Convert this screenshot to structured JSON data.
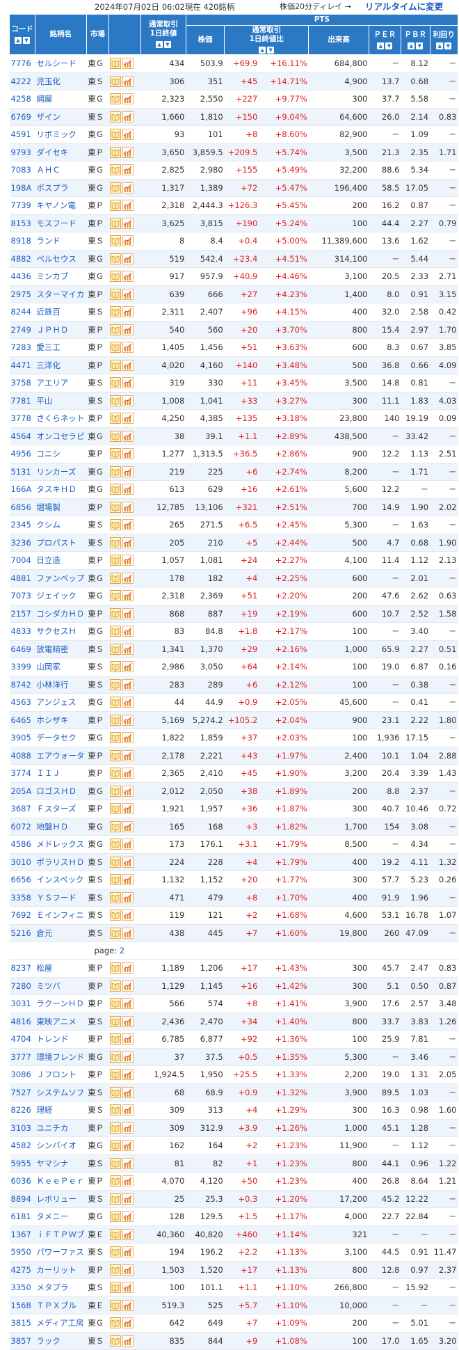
{
  "topbar": {
    "date": "2024年07月02日  06:02現在  420銘柄",
    "delay": "株価20分ディレイ →",
    "realtime_link": "リアルタイムに変更"
  },
  "headers": {
    "code": "コード",
    "name": "銘柄名",
    "market": "市場",
    "pts": "PTS",
    "close": "通常取引\n1日終値",
    "price": "株価",
    "change": "通常取引\n1日終値比",
    "volume": "出来高",
    "per": "ＰＥＲ",
    "pbr": "ＰＢＲ",
    "yield": "利回り"
  },
  "icons": {
    "book": "shikiho-book-icon",
    "chart": "chart-icon"
  },
  "colors": {
    "header_bg": "#2b78c5",
    "link": "#1a5dc0",
    "up": "#e02020"
  },
  "rows": [
    {
      "code": "7776",
      "name": "セルシード",
      "market": "東Ｇ",
      "close": "434",
      "price": "503.9",
      "chg": "+69.9",
      "pct": "+16.11%",
      "vol": "684,800",
      "per": "－",
      "pbr": "8.12",
      "yield": "－"
    },
    {
      "code": "4222",
      "name": "児玉化",
      "market": "東Ｓ",
      "close": "306",
      "price": "351",
      "chg": "+45",
      "pct": "+14.71%",
      "vol": "4,900",
      "per": "13.7",
      "pbr": "0.68",
      "yield": "－"
    },
    {
      "code": "4258",
      "name": "網屋",
      "market": "東Ｇ",
      "close": "2,323",
      "price": "2,550",
      "chg": "+227",
      "pct": "+9.77%",
      "vol": "300",
      "per": "37.7",
      "pbr": "5.58",
      "yield": "－"
    },
    {
      "code": "6769",
      "name": "ザイン",
      "market": "東Ｓ",
      "close": "1,660",
      "price": "1,810",
      "chg": "+150",
      "pct": "+9.04%",
      "vol": "64,600",
      "per": "26.0",
      "pbr": "2.14",
      "yield": "0.83"
    },
    {
      "code": "4591",
      "name": "リボミック",
      "market": "東Ｇ",
      "close": "93",
      "price": "101",
      "chg": "+8",
      "pct": "+8.60%",
      "vol": "82,900",
      "per": "－",
      "pbr": "1.09",
      "yield": "－"
    },
    {
      "code": "9793",
      "name": "ダイセキ",
      "market": "東Ｐ",
      "close": "3,650",
      "price": "3,859.5",
      "chg": "+209.5",
      "pct": "+5.74%",
      "vol": "3,500",
      "per": "21.3",
      "pbr": "2.35",
      "yield": "1.71"
    },
    {
      "code": "7083",
      "name": "ＡＨＣ",
      "market": "東Ｇ",
      "close": "2,825",
      "price": "2,980",
      "chg": "+155",
      "pct": "+5.49%",
      "vol": "32,200",
      "per": "88.6",
      "pbr": "5.34",
      "yield": "－"
    },
    {
      "code": "198A",
      "name": "ポスプラ",
      "market": "東Ｇ",
      "close": "1,317",
      "price": "1,389",
      "chg": "+72",
      "pct": "+5.47%",
      "vol": "196,400",
      "per": "58.5",
      "pbr": "17.05",
      "yield": "－"
    },
    {
      "code": "7739",
      "name": "キヤノン電",
      "market": "東Ｐ",
      "close": "2,318",
      "price": "2,444.3",
      "chg": "+126.3",
      "pct": "+5.45%",
      "vol": "200",
      "per": "16.2",
      "pbr": "0.87",
      "yield": "－"
    },
    {
      "code": "8153",
      "name": "モスフード",
      "market": "東Ｐ",
      "close": "3,625",
      "price": "3,815",
      "chg": "+190",
      "pct": "+5.24%",
      "vol": "100",
      "per": "44.4",
      "pbr": "2.27",
      "yield": "0.79"
    },
    {
      "code": "8918",
      "name": "ランド",
      "market": "東Ｓ",
      "close": "8",
      "price": "8.4",
      "chg": "+0.4",
      "pct": "+5.00%",
      "vol": "11,389,600",
      "per": "13.6",
      "pbr": "1.62",
      "yield": "－"
    },
    {
      "code": "4882",
      "name": "ペルセウス",
      "market": "東Ｇ",
      "close": "519",
      "price": "542.4",
      "chg": "+23.4",
      "pct": "+4.51%",
      "vol": "314,100",
      "per": "－",
      "pbr": "5.44",
      "yield": "－"
    },
    {
      "code": "4436",
      "name": "ミンカブ",
      "market": "東Ｇ",
      "close": "917",
      "price": "957.9",
      "chg": "+40.9",
      "pct": "+4.46%",
      "vol": "3,100",
      "per": "20.5",
      "pbr": "2.33",
      "yield": "2.71"
    },
    {
      "code": "2975",
      "name": "スターマイカ",
      "market": "東Ｐ",
      "close": "639",
      "price": "666",
      "chg": "+27",
      "pct": "+4.23%",
      "vol": "1,400",
      "per": "8.0",
      "pbr": "0.91",
      "yield": "3.15"
    },
    {
      "code": "8244",
      "name": "近鉄百",
      "market": "東Ｓ",
      "close": "2,311",
      "price": "2,407",
      "chg": "+96",
      "pct": "+4.15%",
      "vol": "400",
      "per": "32.0",
      "pbr": "2.58",
      "yield": "0.42"
    },
    {
      "code": "2749",
      "name": "ＪＰＨＤ",
      "market": "東Ｐ",
      "close": "540",
      "price": "560",
      "chg": "+20",
      "pct": "+3.70%",
      "vol": "800",
      "per": "15.4",
      "pbr": "2.97",
      "yield": "1.70"
    },
    {
      "code": "7283",
      "name": "愛三工",
      "market": "東Ｐ",
      "close": "1,405",
      "price": "1,456",
      "chg": "+51",
      "pct": "+3.63%",
      "vol": "600",
      "per": "8.3",
      "pbr": "0.67",
      "yield": "3.85"
    },
    {
      "code": "4471",
      "name": "三洋化",
      "market": "東Ｐ",
      "close": "4,020",
      "price": "4,160",
      "chg": "+140",
      "pct": "+3.48%",
      "vol": "500",
      "per": "36.8",
      "pbr": "0.66",
      "yield": "4.09"
    },
    {
      "code": "3758",
      "name": "アエリア",
      "market": "東Ｓ",
      "close": "319",
      "price": "330",
      "chg": "+11",
      "pct": "+3.45%",
      "vol": "3,500",
      "per": "14.8",
      "pbr": "0.81",
      "yield": "－"
    },
    {
      "code": "7781",
      "name": "平山",
      "market": "東Ｓ",
      "close": "1,008",
      "price": "1,041",
      "chg": "+33",
      "pct": "+3.27%",
      "vol": "300",
      "per": "11.1",
      "pbr": "1.83",
      "yield": "4.03"
    },
    {
      "code": "3778",
      "name": "さくらネット",
      "market": "東Ｐ",
      "close": "4,250",
      "price": "4,385",
      "chg": "+135",
      "pct": "+3.18%",
      "vol": "23,800",
      "per": "140",
      "pbr": "19.19",
      "yield": "0.09"
    },
    {
      "code": "4564",
      "name": "オンコセラピ",
      "market": "東Ｇ",
      "close": "38",
      "price": "39.1",
      "chg": "+1.1",
      "pct": "+2.89%",
      "vol": "438,500",
      "per": "－",
      "pbr": "33.42",
      "yield": "－"
    },
    {
      "code": "4956",
      "name": "コニシ",
      "market": "東Ｐ",
      "close": "1,277",
      "price": "1,313.5",
      "chg": "+36.5",
      "pct": "+2.86%",
      "vol": "900",
      "per": "12.2",
      "pbr": "1.13",
      "yield": "2.51"
    },
    {
      "code": "5131",
      "name": "リンカーズ",
      "market": "東Ｇ",
      "close": "219",
      "price": "225",
      "chg": "+6",
      "pct": "+2.74%",
      "vol": "8,200",
      "per": "－",
      "pbr": "1.71",
      "yield": "－"
    },
    {
      "code": "166A",
      "name": "タスキＨＤ",
      "market": "東Ｇ",
      "close": "613",
      "price": "629",
      "chg": "+16",
      "pct": "+2.61%",
      "vol": "5,600",
      "per": "12.2",
      "pbr": "－",
      "yield": "－"
    },
    {
      "code": "6856",
      "name": "堀場製",
      "market": "東Ｐ",
      "close": "12,785",
      "price": "13,106",
      "chg": "+321",
      "pct": "+2.51%",
      "vol": "700",
      "per": "14.9",
      "pbr": "1.90",
      "yield": "2.02"
    },
    {
      "code": "2345",
      "name": "クシム",
      "market": "東Ｓ",
      "close": "265",
      "price": "271.5",
      "chg": "+6.5",
      "pct": "+2.45%",
      "vol": "5,300",
      "per": "－",
      "pbr": "1.63",
      "yield": "－"
    },
    {
      "code": "3236",
      "name": "プロパスト",
      "market": "東Ｓ",
      "close": "205",
      "price": "210",
      "chg": "+5",
      "pct": "+2.44%",
      "vol": "500",
      "per": "4.7",
      "pbr": "0.68",
      "yield": "1.90"
    },
    {
      "code": "7004",
      "name": "日立造",
      "market": "東Ｐ",
      "close": "1,057",
      "price": "1,081",
      "chg": "+24",
      "pct": "+2.27%",
      "vol": "4,100",
      "per": "11.4",
      "pbr": "1.12",
      "yield": "2.13"
    },
    {
      "code": "4881",
      "name": "ファンペップ",
      "market": "東Ｇ",
      "close": "178",
      "price": "182",
      "chg": "+4",
      "pct": "+2.25%",
      "vol": "600",
      "per": "－",
      "pbr": "2.01",
      "yield": "－"
    },
    {
      "code": "7073",
      "name": "ジェイック",
      "market": "東Ｇ",
      "close": "2,318",
      "price": "2,369",
      "chg": "+51",
      "pct": "+2.20%",
      "vol": "200",
      "per": "47.6",
      "pbr": "2.62",
      "yield": "0.63"
    },
    {
      "code": "2157",
      "name": "コシダカＨＤ",
      "market": "東Ｐ",
      "close": "868",
      "price": "887",
      "chg": "+19",
      "pct": "+2.19%",
      "vol": "600",
      "per": "10.7",
      "pbr": "2.52",
      "yield": "1.58"
    },
    {
      "code": "4833",
      "name": "サクセスＨ",
      "market": "東Ｇ",
      "close": "83",
      "price": "84.8",
      "chg": "+1.8",
      "pct": "+2.17%",
      "vol": "100",
      "per": "－",
      "pbr": "3.40",
      "yield": "－"
    },
    {
      "code": "6469",
      "name": "放電精密",
      "market": "東Ｓ",
      "close": "1,341",
      "price": "1,370",
      "chg": "+29",
      "pct": "+2.16%",
      "vol": "1,000",
      "per": "65.9",
      "pbr": "2.27",
      "yield": "0.51"
    },
    {
      "code": "3399",
      "name": "山岡家",
      "market": "東Ｓ",
      "close": "2,986",
      "price": "3,050",
      "chg": "+64",
      "pct": "+2.14%",
      "vol": "100",
      "per": "19.0",
      "pbr": "6.87",
      "yield": "0.16"
    },
    {
      "code": "8742",
      "name": "小林洋行",
      "market": "東Ｓ",
      "close": "283",
      "price": "289",
      "chg": "+6",
      "pct": "+2.12%",
      "vol": "100",
      "per": "－",
      "pbr": "0.38",
      "yield": "－"
    },
    {
      "code": "4563",
      "name": "アンジェス",
      "market": "東Ｇ",
      "close": "44",
      "price": "44.9",
      "chg": "+0.9",
      "pct": "+2.05%",
      "vol": "45,600",
      "per": "－",
      "pbr": "0.41",
      "yield": "－"
    },
    {
      "code": "6465",
      "name": "ホシザキ",
      "market": "東Ｐ",
      "close": "5,169",
      "price": "5,274.2",
      "chg": "+105.2",
      "pct": "+2.04%",
      "vol": "900",
      "per": "23.1",
      "pbr": "2.22",
      "yield": "1.80"
    },
    {
      "code": "3905",
      "name": "データセク",
      "market": "東Ｇ",
      "close": "1,822",
      "price": "1,859",
      "chg": "+37",
      "pct": "+2.03%",
      "vol": "100",
      "per": "1,936",
      "pbr": "17.15",
      "yield": "－"
    },
    {
      "code": "4088",
      "name": "エアウォータ",
      "market": "東Ｐ",
      "close": "2,178",
      "price": "2,221",
      "chg": "+43",
      "pct": "+1.97%",
      "vol": "2,400",
      "per": "10.1",
      "pbr": "1.04",
      "yield": "2.88"
    },
    {
      "code": "3774",
      "name": "ＩＩＪ",
      "market": "東Ｐ",
      "close": "2,365",
      "price": "2,410",
      "chg": "+45",
      "pct": "+1.90%",
      "vol": "3,200",
      "per": "20.4",
      "pbr": "3.39",
      "yield": "1.43"
    },
    {
      "code": "205A",
      "name": "ロゴスＨＤ",
      "market": "東Ｇ",
      "close": "2,012",
      "price": "2,050",
      "chg": "+38",
      "pct": "+1.89%",
      "vol": "200",
      "per": "8.8",
      "pbr": "2.37",
      "yield": "－"
    },
    {
      "code": "3687",
      "name": "Ｆスターズ",
      "market": "東Ｐ",
      "close": "1,921",
      "price": "1,957",
      "chg": "+36",
      "pct": "+1.87%",
      "vol": "300",
      "per": "40.7",
      "pbr": "10.46",
      "yield": "0.72"
    },
    {
      "code": "6072",
      "name": "地盤ＨＤ",
      "market": "東Ｇ",
      "close": "165",
      "price": "168",
      "chg": "+3",
      "pct": "+1.82%",
      "vol": "1,700",
      "per": "154",
      "pbr": "3.08",
      "yield": "－"
    },
    {
      "code": "4586",
      "name": "メドレックス",
      "market": "東Ｇ",
      "close": "173",
      "price": "176.1",
      "chg": "+3.1",
      "pct": "+1.79%",
      "vol": "8,500",
      "per": "－",
      "pbr": "4.34",
      "yield": "－"
    },
    {
      "code": "3010",
      "name": "ポラリスＨＤ",
      "market": "東Ｓ",
      "close": "224",
      "price": "228",
      "chg": "+4",
      "pct": "+1.79%",
      "vol": "400",
      "per": "19.2",
      "pbr": "4.11",
      "yield": "1.32"
    },
    {
      "code": "6656",
      "name": "インスペック",
      "market": "東Ｓ",
      "close": "1,132",
      "price": "1,152",
      "chg": "+20",
      "pct": "+1.77%",
      "vol": "300",
      "per": "57.7",
      "pbr": "5.23",
      "yield": "0.26"
    },
    {
      "code": "3358",
      "name": "ＹＳフード",
      "market": "東Ｓ",
      "close": "471",
      "price": "479",
      "chg": "+8",
      "pct": "+1.70%",
      "vol": "400",
      "per": "91.9",
      "pbr": "1.96",
      "yield": "－"
    },
    {
      "code": "7692",
      "name": "Ｅインフィニ",
      "market": "東Ｓ",
      "close": "119",
      "price": "121",
      "chg": "+2",
      "pct": "+1.68%",
      "vol": "4,600",
      "per": "53.1",
      "pbr": "16.78",
      "yield": "1.07"
    },
    {
      "code": "5216",
      "name": "倉元",
      "market": "東Ｓ",
      "close": "438",
      "price": "445",
      "chg": "+7",
      "pct": "+1.60%",
      "vol": "19,800",
      "per": "260",
      "pbr": "47.09",
      "yield": "－"
    }
  ],
  "pager": {
    "label": "page:",
    "page": "2"
  },
  "rows2": [
    {
      "code": "8237",
      "name": "松屋",
      "market": "東Ｐ",
      "close": "1,189",
      "price": "1,206",
      "chg": "+17",
      "pct": "+1.43%",
      "vol": "300",
      "per": "45.7",
      "pbr": "2.47",
      "yield": "0.83"
    },
    {
      "code": "7280",
      "name": "ミツバ",
      "market": "東Ｐ",
      "close": "1,129",
      "price": "1,145",
      "chg": "+16",
      "pct": "+1.42%",
      "vol": "300",
      "per": "5.1",
      "pbr": "0.50",
      "yield": "0.87"
    },
    {
      "code": "3031",
      "name": "ラクーンＨＤ",
      "market": "東Ｐ",
      "close": "566",
      "price": "574",
      "chg": "+8",
      "pct": "+1.41%",
      "vol": "3,900",
      "per": "17.6",
      "pbr": "2.57",
      "yield": "3.48"
    },
    {
      "code": "4816",
      "name": "東映アニメ",
      "market": "東Ｓ",
      "close": "2,436",
      "price": "2,470",
      "chg": "+34",
      "pct": "+1.40%",
      "vol": "800",
      "per": "33.7",
      "pbr": "3.83",
      "yield": "1.26"
    },
    {
      "code": "4704",
      "name": "トレンド",
      "market": "東Ｐ",
      "close": "6,785",
      "price": "6,877",
      "chg": "+92",
      "pct": "+1.36%",
      "vol": "100",
      "per": "25.9",
      "pbr": "7.81",
      "yield": "－"
    },
    {
      "code": "3777",
      "name": "環境フレンド",
      "market": "東Ｇ",
      "close": "37",
      "price": "37.5",
      "chg": "+0.5",
      "pct": "+1.35%",
      "vol": "5,300",
      "per": "－",
      "pbr": "3.46",
      "yield": "－"
    },
    {
      "code": "3086",
      "name": "Ｊフロント",
      "market": "東Ｐ",
      "close": "1,924.5",
      "price": "1,950",
      "chg": "+25.5",
      "pct": "+1.33%",
      "vol": "2,200",
      "per": "19.0",
      "pbr": "1.31",
      "yield": "2.05"
    },
    {
      "code": "7527",
      "name": "システムソフ",
      "market": "東Ｓ",
      "close": "68",
      "price": "68.9",
      "chg": "+0.9",
      "pct": "+1.32%",
      "vol": "3,900",
      "per": "89.5",
      "pbr": "1.03",
      "yield": "－"
    },
    {
      "code": "8226",
      "name": "理経",
      "market": "東Ｓ",
      "close": "309",
      "price": "313",
      "chg": "+4",
      "pct": "+1.29%",
      "vol": "300",
      "per": "16.3",
      "pbr": "0.98",
      "yield": "1.60"
    },
    {
      "code": "3103",
      "name": "ユニチカ",
      "market": "東Ｐ",
      "close": "309",
      "price": "312.9",
      "chg": "+3.9",
      "pct": "+1.26%",
      "vol": "1,000",
      "per": "45.1",
      "pbr": "1.28",
      "yield": "－"
    },
    {
      "code": "4582",
      "name": "シンバイオ",
      "market": "東Ｇ",
      "close": "162",
      "price": "164",
      "chg": "+2",
      "pct": "+1.23%",
      "vol": "11,900",
      "per": "－",
      "pbr": "1.12",
      "yield": "－"
    },
    {
      "code": "5955",
      "name": "ヤマシナ",
      "market": "東Ｓ",
      "close": "81",
      "price": "82",
      "chg": "+1",
      "pct": "+1.23%",
      "vol": "800",
      "per": "44.1",
      "pbr": "0.96",
      "yield": "1.22"
    },
    {
      "code": "6036",
      "name": "ＫｅｅＰｅｒ",
      "market": "東Ｐ",
      "close": "4,070",
      "price": "4,120",
      "chg": "+50",
      "pct": "+1.23%",
      "vol": "400",
      "per": "26.8",
      "pbr": "8.64",
      "yield": "1.21"
    },
    {
      "code": "8894",
      "name": "レボリュー",
      "market": "東Ｓ",
      "close": "25",
      "price": "25.3",
      "chg": "+0.3",
      "pct": "+1.20%",
      "vol": "17,200",
      "per": "45.2",
      "pbr": "12.22",
      "yield": "－"
    },
    {
      "code": "6181",
      "name": "タメニー",
      "market": "東Ｇ",
      "close": "128",
      "price": "129.5",
      "chg": "+1.5",
      "pct": "+1.17%",
      "vol": "4,000",
      "per": "22.7",
      "pbr": "22.84",
      "yield": "－"
    },
    {
      "code": "1367",
      "name": "ｉＦＴＰＷブ",
      "market": "東Ｅ",
      "close": "40,360",
      "price": "40,820",
      "chg": "+460",
      "pct": "+1.14%",
      "vol": "321",
      "per": "－",
      "pbr": "－",
      "yield": "－"
    },
    {
      "code": "5950",
      "name": "パワーファス",
      "market": "東Ｓ",
      "close": "194",
      "price": "196.2",
      "chg": "+2.2",
      "pct": "+1.13%",
      "vol": "3,100",
      "per": "44.5",
      "pbr": "0.91",
      "yield": "11.47"
    },
    {
      "code": "4275",
      "name": "カーリット",
      "market": "東Ｐ",
      "close": "1,503",
      "price": "1,520",
      "chg": "+17",
      "pct": "+1.13%",
      "vol": "800",
      "per": "12.8",
      "pbr": "0.97",
      "yield": "2.37"
    },
    {
      "code": "3350",
      "name": "メタプラ",
      "market": "東Ｓ",
      "close": "100",
      "price": "101.1",
      "chg": "+1.1",
      "pct": "+1.10%",
      "vol": "266,800",
      "per": "－",
      "pbr": "15.92",
      "yield": "－"
    },
    {
      "code": "1568",
      "name": "ＴＰＸブル",
      "market": "東Ｅ",
      "close": "519.3",
      "price": "525",
      "chg": "+5.7",
      "pct": "+1.10%",
      "vol": "10,000",
      "per": "－",
      "pbr": "－",
      "yield": "－"
    },
    {
      "code": "3815",
      "name": "メディア工房",
      "market": "東Ｇ",
      "close": "642",
      "price": "649",
      "chg": "+7",
      "pct": "+1.09%",
      "vol": "200",
      "per": "－",
      "pbr": "5.01",
      "yield": "－"
    },
    {
      "code": "3857",
      "name": "ラック",
      "market": "東Ｓ",
      "close": "835",
      "price": "844",
      "chg": "+9",
      "pct": "+1.08%",
      "vol": "100",
      "per": "17.0",
      "pbr": "1.65",
      "yield": "3.20"
    }
  ]
}
